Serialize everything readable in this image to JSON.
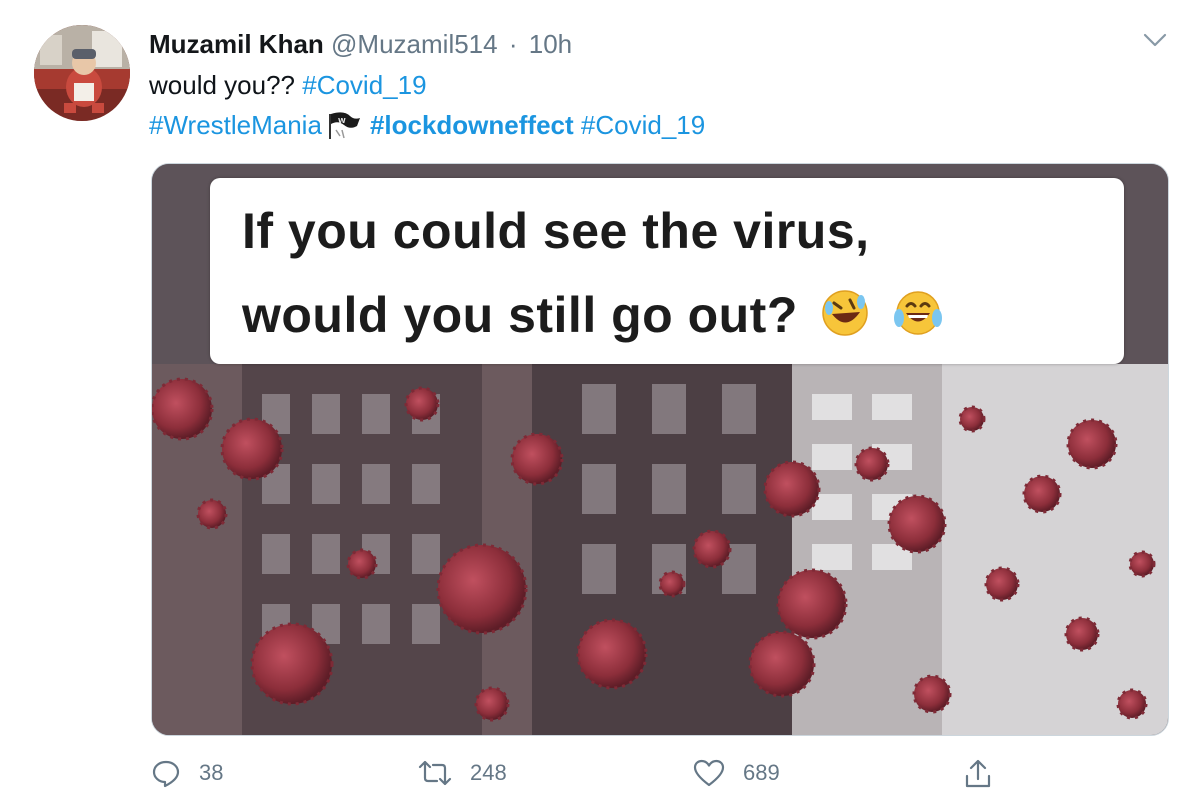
{
  "author": {
    "name": "Muzamil Khan",
    "handle": "@Muzamil514",
    "separator": "·",
    "time": "10h"
  },
  "tweet": {
    "text_plain": "would you??",
    "hashtag_covid": "#Covid_19",
    "hashtag_wrestlemania": "#WrestleMania",
    "hashtag_lockdown": "#lockdowneffect",
    "hashtag_covid_2": "#Covid_19"
  },
  "media": {
    "caption_line1": "If you could see the virus,",
    "caption_line2": "would you still go out?"
  },
  "actions": {
    "replies": "38",
    "retweets": "248",
    "likes": "689"
  },
  "icons": {
    "more": "chevron-down-icon",
    "reply": "reply-icon",
    "retweet": "retweet-icon",
    "like": "heart-icon",
    "share": "share-icon",
    "wrestlemania": "wrestlemania-flag-icon",
    "rofl": "rolling-laughing-emoji-icon",
    "tears": "tears-of-joy-emoji-icon"
  },
  "colors": {
    "link": "#1b95e0",
    "secondary_text": "#657786"
  }
}
